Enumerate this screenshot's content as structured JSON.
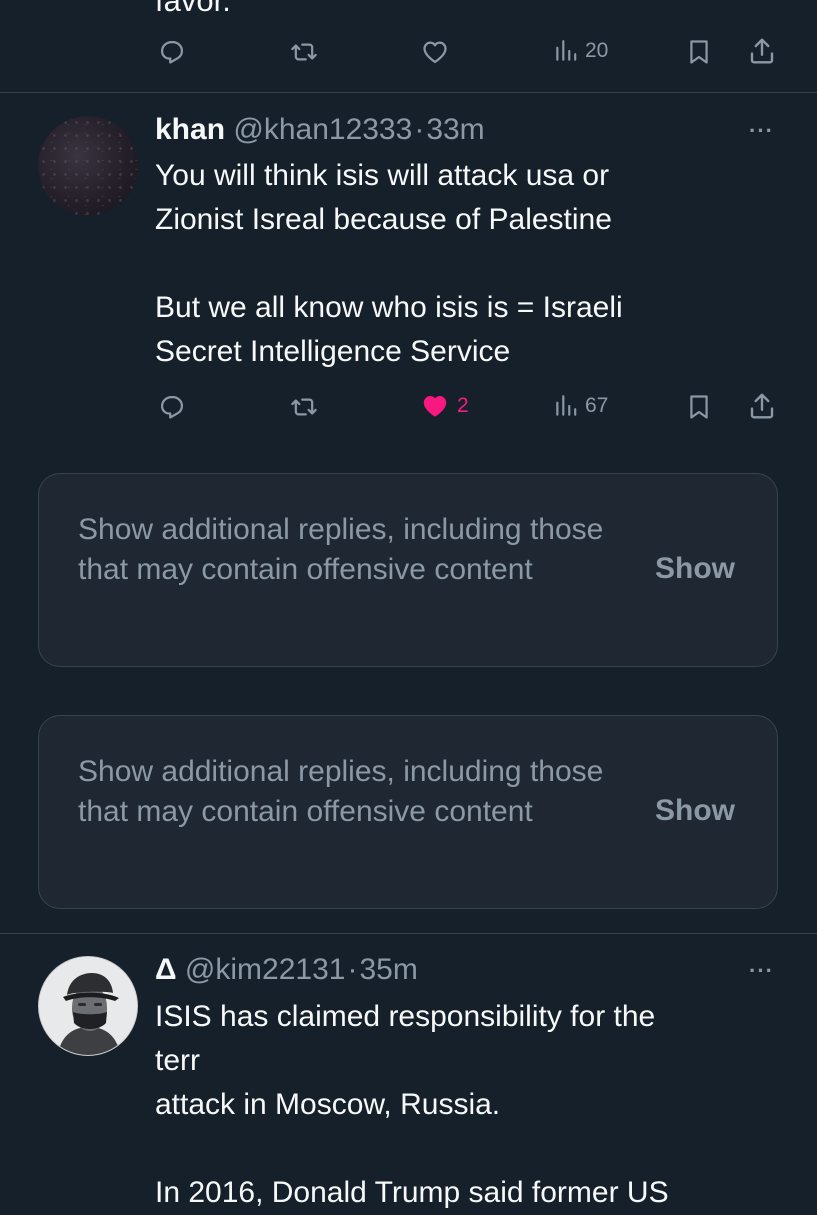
{
  "top_tweet": {
    "cut_text": "favor.",
    "views": "20"
  },
  "tweet1": {
    "display_name": "khan",
    "handle": "@khan12333",
    "separator": "·",
    "time": "33m",
    "text": "You will think isis will attack usa or\nZionist Isreal because  of Palestine\n\nBut we all know who isis is = Israeli\nSecret Intelligence Service",
    "likes": "2",
    "views": "67"
  },
  "notices": [
    {
      "message": "Show additional replies, including those that may contain offensive content",
      "button": "Show"
    },
    {
      "message": "Show additional replies, including those that may contain offensive content",
      "button": "Show"
    }
  ],
  "tweet2": {
    "display_name": "Δ",
    "handle": "@kim22131",
    "separator": "·",
    "time": "35m",
    "text": "ISIS has claimed responsibility for the\nterr\nattack in Moscow, Russia.\n\nIn 2016, Donald Trump said former US"
  },
  "more_symbol": "···",
  "colors": {
    "background": "#15202b",
    "muted": "#8b98a5",
    "like_active": "#f91880",
    "divider": "#38444d"
  },
  "icons": [
    "reply-icon",
    "retweet-icon",
    "like-icon",
    "views-icon",
    "bookmark-icon",
    "share-icon",
    "more-icon"
  ]
}
